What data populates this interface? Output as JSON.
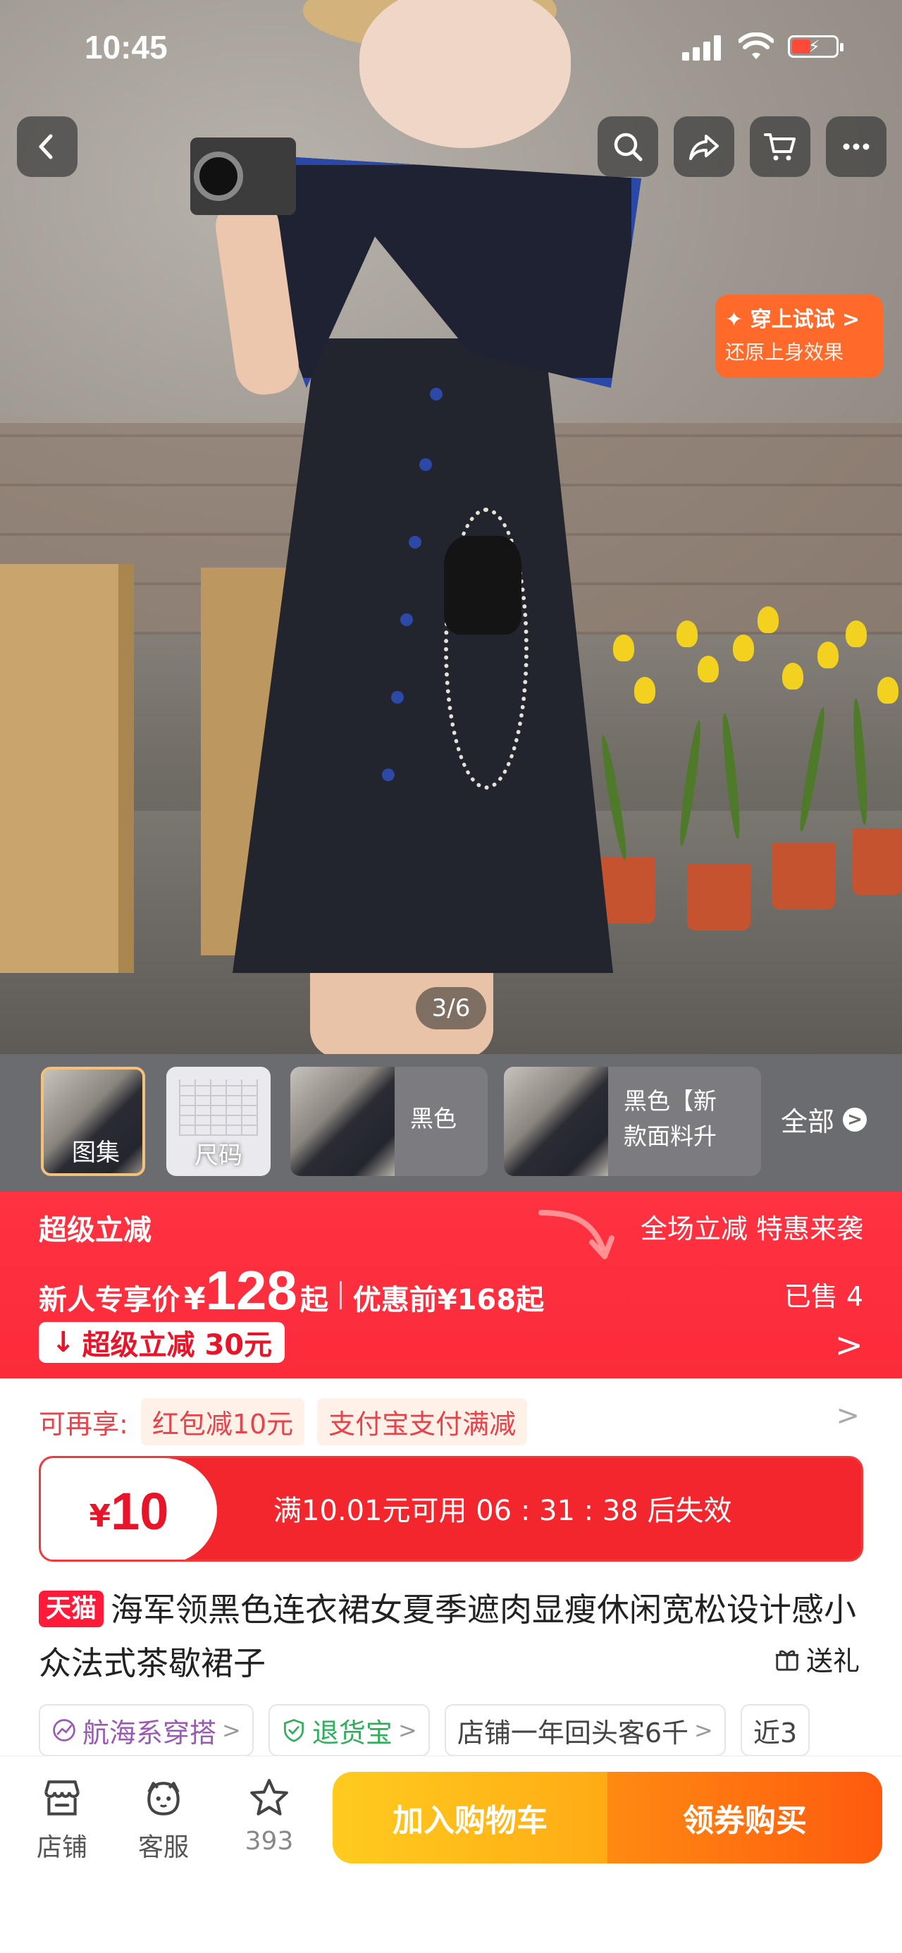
{
  "status_bar": {
    "time": "10:45"
  },
  "hero": {
    "image_counter": "3/6",
    "try_on": {
      "line1": "✦ 穿上试试 >",
      "line2": "还原上身效果"
    }
  },
  "top_nav": {
    "icons": [
      "back-icon",
      "search-icon",
      "share-icon",
      "cart-icon",
      "more-icon"
    ]
  },
  "thumbnails": [
    {
      "caption": "图集"
    },
    {
      "caption": "尺码"
    },
    {
      "label": "黑色"
    },
    {
      "label_line1": "黑色【新",
      "label_line2": "款面料升"
    }
  ],
  "all_button": {
    "label": "全部",
    "chevron": ">"
  },
  "promo": {
    "title": "超级立减",
    "slogan": "全场立减 特惠来袭",
    "price_label": "新人专享价",
    "currency": "¥",
    "price": "128",
    "price_suffix": "起",
    "original_label": "优惠前¥168起",
    "sold": "已售 4",
    "tag": "超级立减 30元",
    "tag_icon": "↓",
    "chevron": ">",
    "colors": {
      "bg": "#ff3242"
    }
  },
  "extra_offers": {
    "label": "可再享:",
    "chips": [
      "红包减10元",
      "支付宝支付满减"
    ],
    "chevron": ">"
  },
  "coupon": {
    "currency": "¥",
    "amount": "10",
    "description": "满10.01元可用  06 : 31 : 38 后失效"
  },
  "product": {
    "badge": "天猫",
    "title": "海军领黑色连衣裙女夏季遮肉显瘦休闲宽松设计感小众法式茶歇裙子",
    "gift_label": "送礼"
  },
  "pills": [
    {
      "label": "航海系穿搭",
      "chevron": ">"
    },
    {
      "label": "退货宝",
      "chevron": ">"
    },
    {
      "label": "店铺一年回头客6千",
      "chevron": ">"
    },
    {
      "label": "近3"
    }
  ],
  "bottom_bar": {
    "shop_label": "店铺",
    "service_label": "客服",
    "favorite_count": "393",
    "add_to_cart": "加入购物车",
    "buy_with_coupon": "领券购买"
  }
}
